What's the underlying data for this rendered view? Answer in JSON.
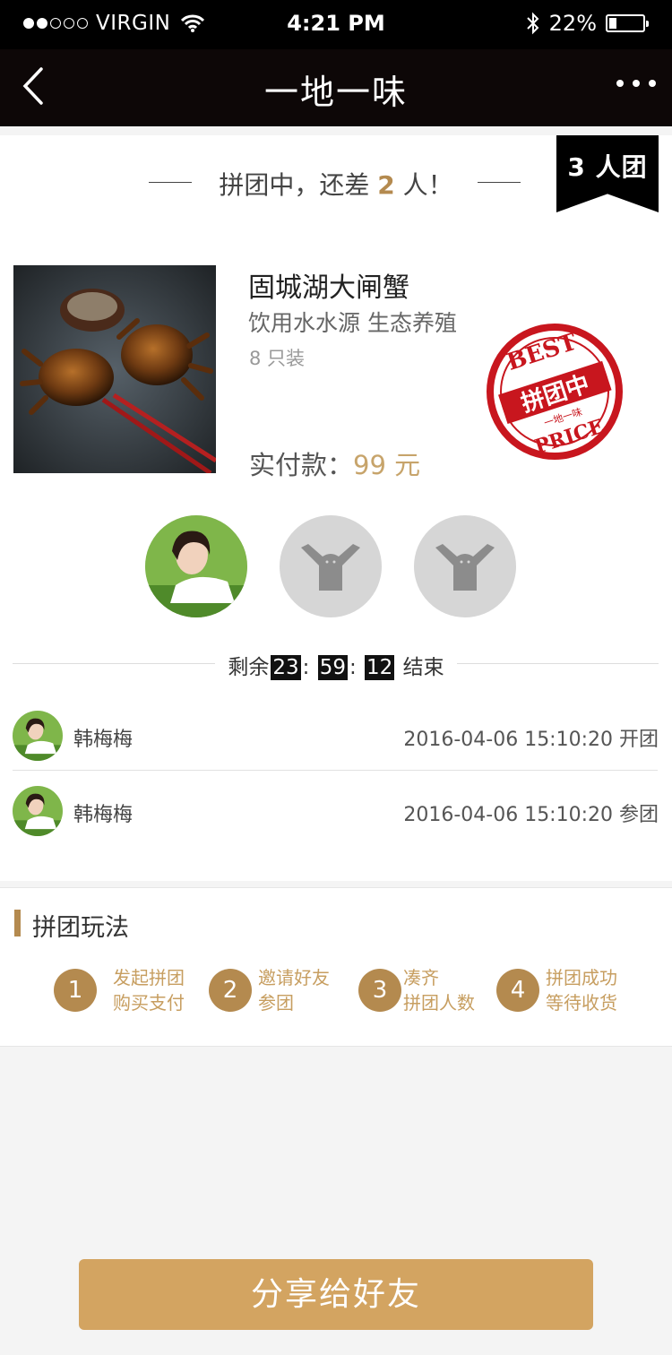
{
  "status_bar": {
    "carrier": "VIRGIN",
    "time": "4:21 PM",
    "battery": "22%",
    "battery_level": 0.22
  },
  "nav": {
    "title": "一地一味",
    "back_icon": "chevron-left-icon",
    "more_icon": "more-dots-icon"
  },
  "group": {
    "status_prefix": "拼团中，还差",
    "remaining": "2",
    "status_suffix": "人！",
    "ribbon": "3 人团"
  },
  "product": {
    "name": "固城湖大闸蟹",
    "desc": "饮用水水源 生态养殖",
    "qty": "8 只装",
    "pay_label": "实付款：",
    "price": "99 元",
    "stamp_top": "BEST",
    "stamp_center": "拼团中",
    "stamp_sub": "一地一味",
    "stamp_bottom": "PRICE"
  },
  "countdown": {
    "prefix": "剩余",
    "hours": "23",
    "minutes": "59",
    "seconds": "12",
    "sep": ":",
    "suffix": "结束"
  },
  "members": [
    {
      "name": "韩梅梅",
      "time": "2016-04-06 15:10:20 开团"
    },
    {
      "name": "韩梅梅",
      "time": "2016-04-06 15:10:20 参团"
    }
  ],
  "rules": {
    "title": "拼团玩法",
    "steps": [
      {
        "num": "1",
        "line1": "发起拼团",
        "line2": "购买支付"
      },
      {
        "num": "2",
        "line1": "邀请好友",
        "line2": "参团"
      },
      {
        "num": "3",
        "line1": "凑齐",
        "line2": "拼团人数"
      },
      {
        "num": "4",
        "line1": "拼团成功",
        "line2": "等待收货"
      }
    ]
  },
  "share_button": "分享给好友",
  "colors": {
    "accent": "#b48a4f",
    "button": "#d3a461",
    "price": "#c7a46b",
    "stamp": "#c8161e"
  }
}
